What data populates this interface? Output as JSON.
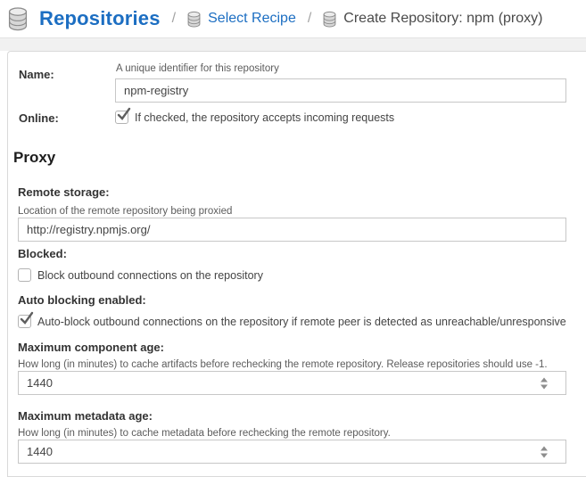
{
  "breadcrumb": {
    "root": "Repositories",
    "separator": "/",
    "select_recipe": "Select Recipe",
    "current": "Create Repository: npm (proxy)"
  },
  "icons": {
    "repositories": "database-icon",
    "select_recipe": "database-icon",
    "create_repository": "database-icon"
  },
  "colors": {
    "link_blue": "#1c6ec2",
    "band_gray": "#f1f1f1",
    "panel_border": "#d9d9d9",
    "check_gray": "#5f5f5f"
  },
  "form": {
    "name": {
      "label": "Name:",
      "help": "A unique identifier for this repository",
      "value": "npm-registry"
    },
    "online": {
      "label": "Online:",
      "caption": "If checked, the repository accepts incoming requests",
      "checked": true
    },
    "proxy": {
      "title": "Proxy",
      "remote_storage": {
        "label": "Remote storage:",
        "help": "Location of the remote repository being proxied",
        "value": "http://registry.npmjs.org/"
      },
      "blocked": {
        "label": "Blocked:",
        "caption": "Block outbound connections on the repository",
        "checked": false
      },
      "auto_blocking": {
        "label": "Auto blocking enabled:",
        "caption": "Auto-block outbound connections on the repository if remote peer is detected as unreachable/unresponsive",
        "checked": true
      },
      "max_component_age": {
        "label": "Maximum component age:",
        "help": "How long (in minutes) to cache artifacts before rechecking the remote repository. Release repositories should use -1.",
        "value": "1440"
      },
      "max_metadata_age": {
        "label": "Maximum metadata age:",
        "help": "How long (in minutes) to cache metadata before rechecking the remote repository.",
        "value": "1440"
      }
    }
  }
}
